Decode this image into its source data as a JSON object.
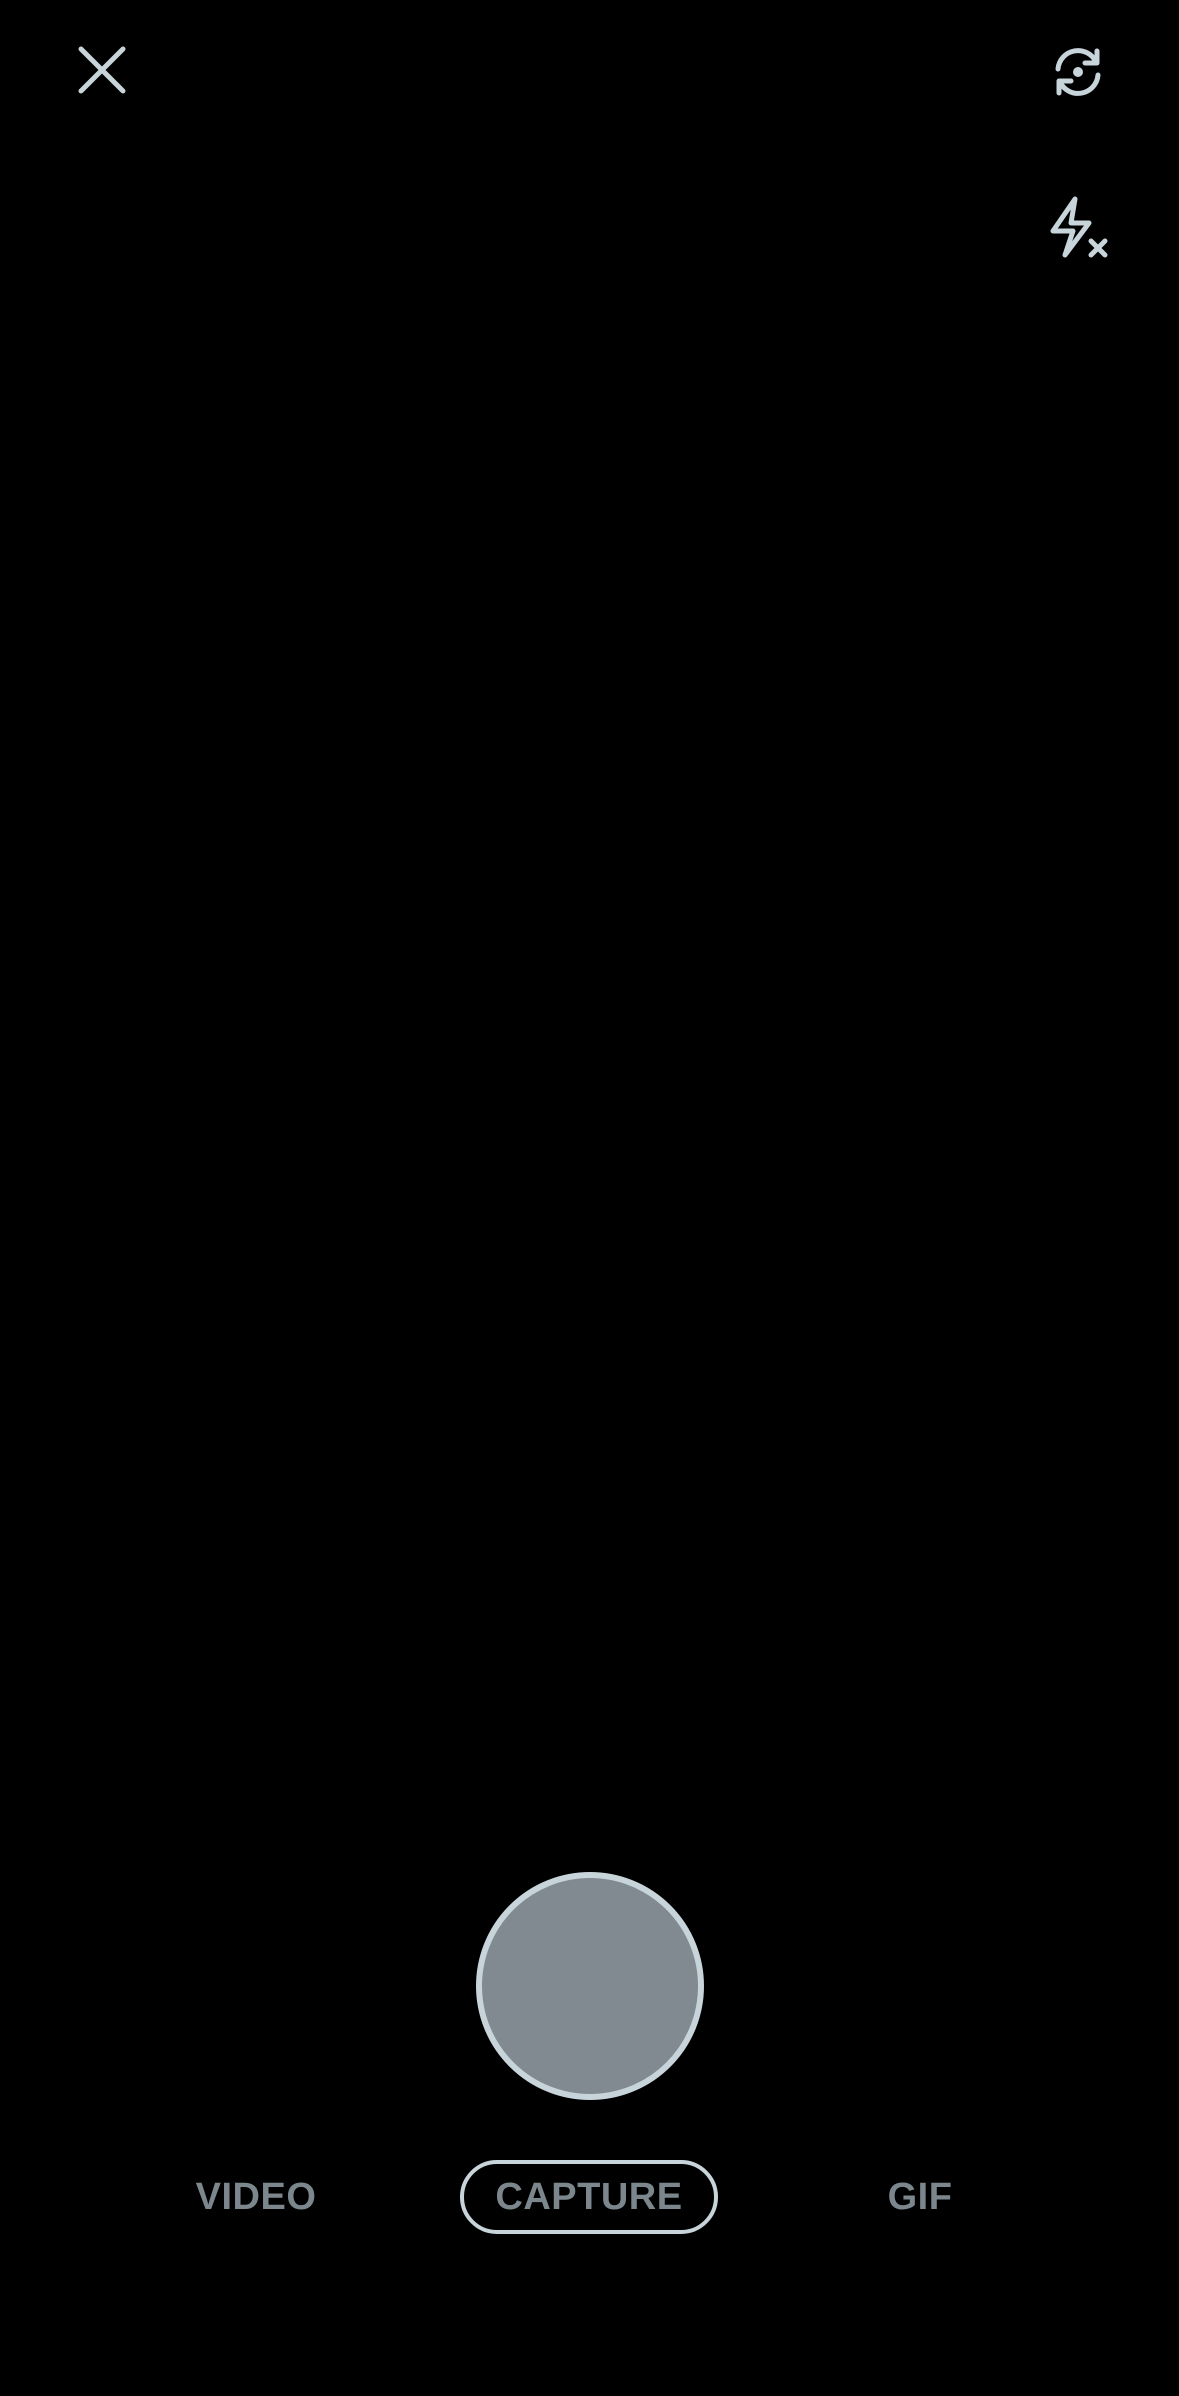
{
  "top_bar": {
    "close_icon": "close-icon",
    "flip_camera_icon": "flip-camera-icon",
    "flash_icon": "flash-off-icon"
  },
  "shutter": {
    "icon": "shutter-button"
  },
  "modes": {
    "video_label": "VIDEO",
    "capture_label": "CAPTURE",
    "gif_label": "GIF",
    "selected": "CAPTURE"
  },
  "colors": {
    "background": "#000000",
    "icon": "#c7d4da",
    "shutter_fill": "#818a90",
    "mode_text": "#7c878d"
  }
}
